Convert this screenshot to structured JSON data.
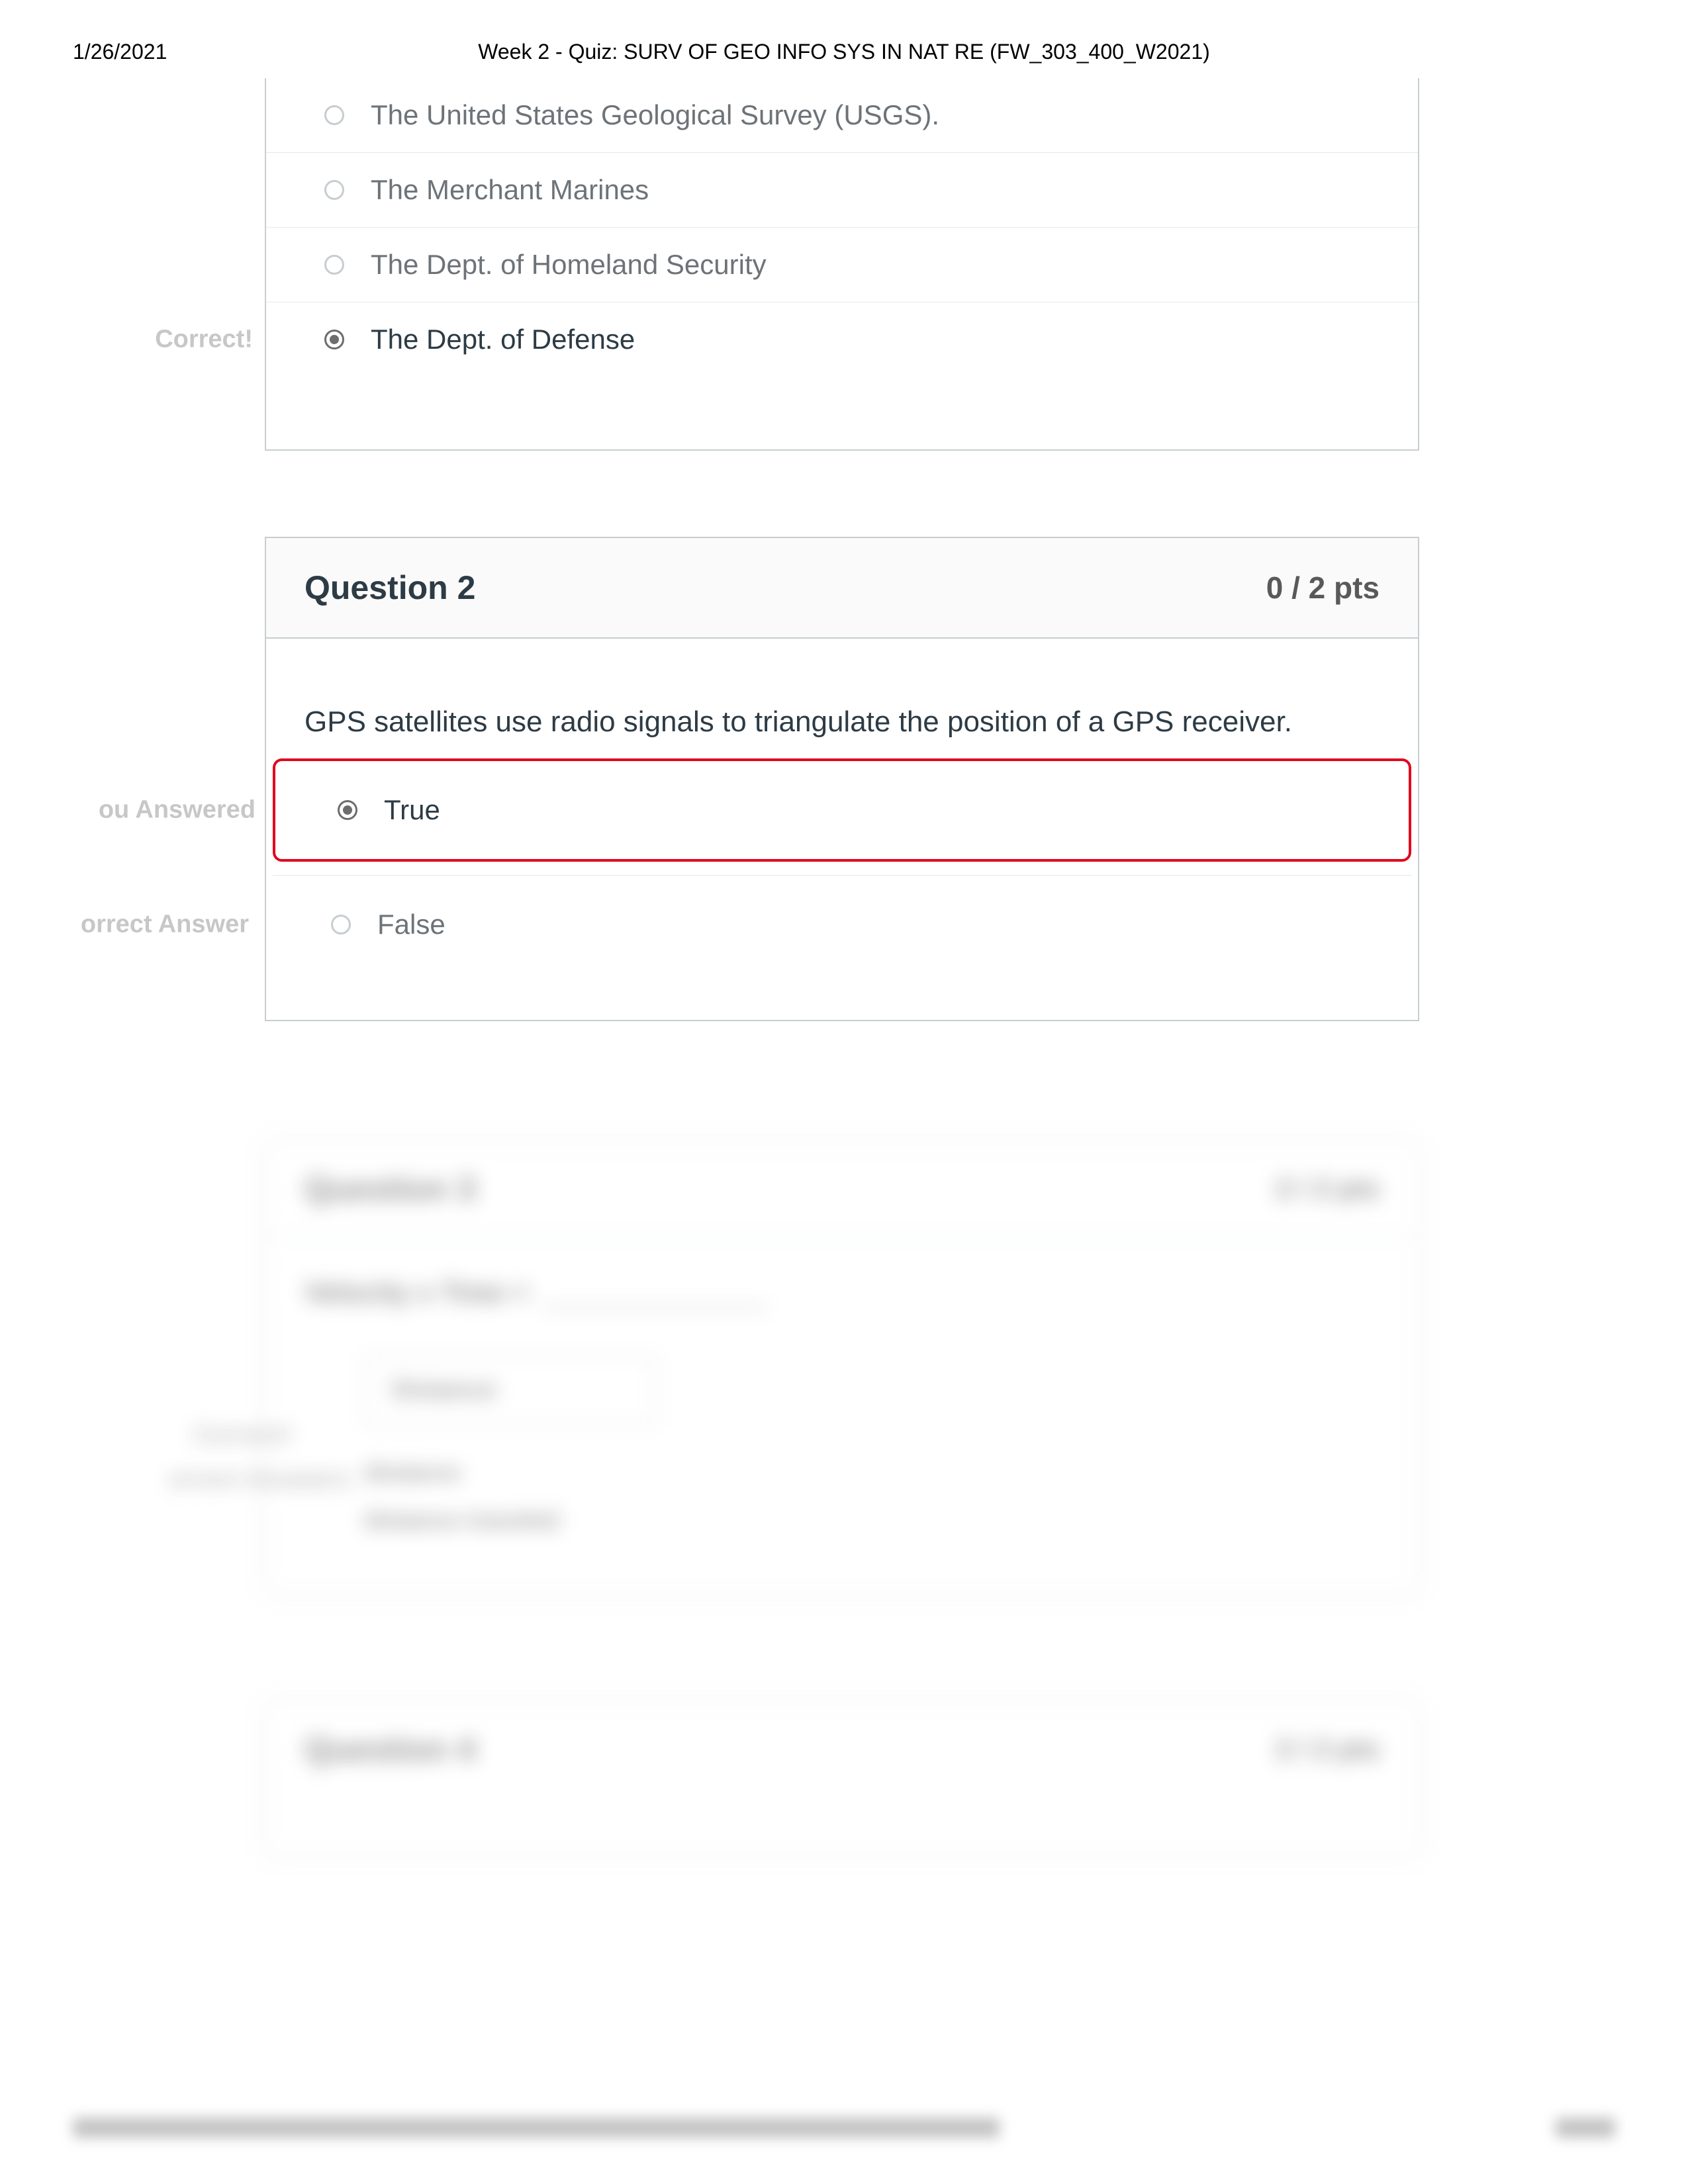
{
  "header": {
    "date": "1/26/2021",
    "title": "Week 2 - Quiz: SURV OF GEO INFO SYS IN NAT RE (FW_303_400_W2021)"
  },
  "q1": {
    "options": [
      {
        "label": "The United States Geological Survey (USGS).",
        "selected": false
      },
      {
        "label": "The Merchant Marines",
        "selected": false
      },
      {
        "label": "The Dept. of Homeland Security",
        "selected": false
      },
      {
        "label": "The Dept. of Defense",
        "selected": true
      }
    ],
    "feedback_correct": "Correct!"
  },
  "q2": {
    "title": "Question 2",
    "points": "0 / 2 pts",
    "prompt": "GPS satellites use radio signals to triangulate the position of a GPS receiver.",
    "options": [
      {
        "label": "True",
        "selected": true,
        "wrong": true
      },
      {
        "label": "False",
        "selected": false
      }
    ],
    "feedback_you_answered": "ou Answered",
    "feedback_correct_answer": "orrect Answer"
  },
  "q3": {
    "title": "Question 3",
    "points": "2 / 2 pts",
    "prompt": "Velocity x Time =",
    "box_value": "Distance",
    "feedback_correct": "Correct!",
    "correct_answers_label": "orrect Answers",
    "answers": [
      "distance",
      "distance traveled"
    ]
  },
  "q4": {
    "title": "Question 4",
    "points": "2 / 2 pts"
  }
}
